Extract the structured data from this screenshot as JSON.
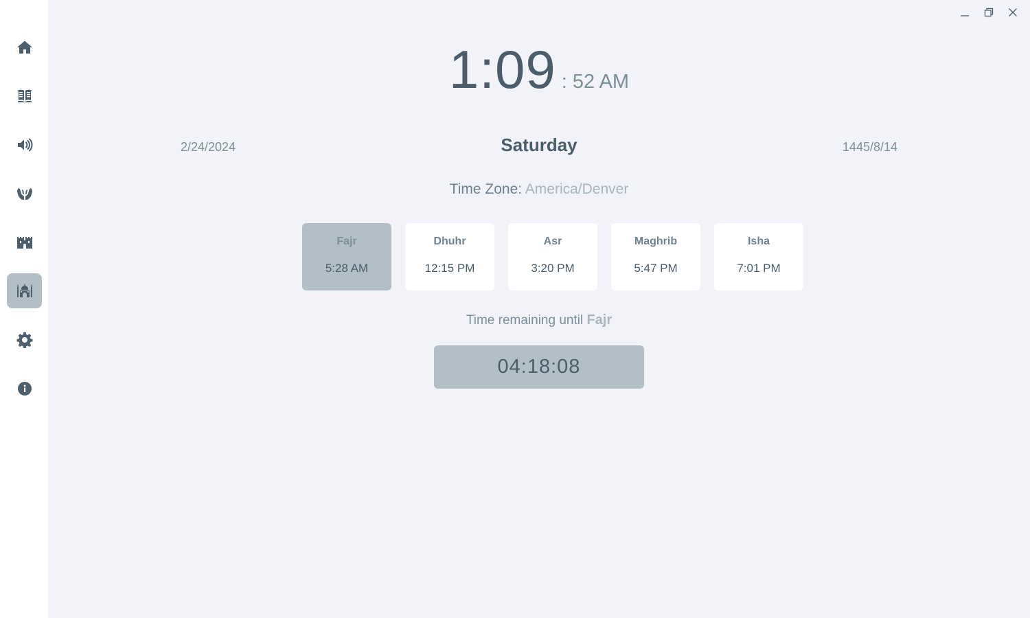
{
  "sidebar": {
    "items": [
      {
        "icon": "home-icon"
      },
      {
        "icon": "quran-book-icon"
      },
      {
        "icon": "audio-speaker-icon"
      },
      {
        "icon": "praying-hands-icon"
      },
      {
        "icon": "fortress-icon"
      },
      {
        "icon": "mosque-icon",
        "active": true
      },
      {
        "icon": "gear-icon"
      },
      {
        "icon": "info-icon"
      }
    ]
  },
  "window_controls": [
    "minimize-icon",
    "restore-icon",
    "close-icon"
  ],
  "clock": {
    "hours_minutes": "1:09",
    "seconds_ampm": ": 52 AM"
  },
  "dates": {
    "gregorian": "2/24/2024",
    "day": "Saturday",
    "hijri": "1445/8/14"
  },
  "timezone": {
    "label": "Time Zone: ",
    "value": "America/Denver"
  },
  "prayers": [
    {
      "name": "Fajr",
      "time": "5:28 AM",
      "active": true
    },
    {
      "name": "Dhuhr",
      "time": "12:15 PM"
    },
    {
      "name": "Asr",
      "time": "3:20 PM"
    },
    {
      "name": "Maghrib",
      "time": "5:47 PM"
    },
    {
      "name": "Isha",
      "time": "7:01 PM"
    }
  ],
  "remaining": {
    "label": "Time remaining until ",
    "next_prayer": "Fajr",
    "countdown": "04:18:08"
  },
  "colors": {
    "background": "#f1f3f8",
    "sidebar": "#ffffff",
    "accent": "#b2bfc7",
    "text_dark": "#4b5d6b",
    "text_muted": "#7c8f9b"
  }
}
